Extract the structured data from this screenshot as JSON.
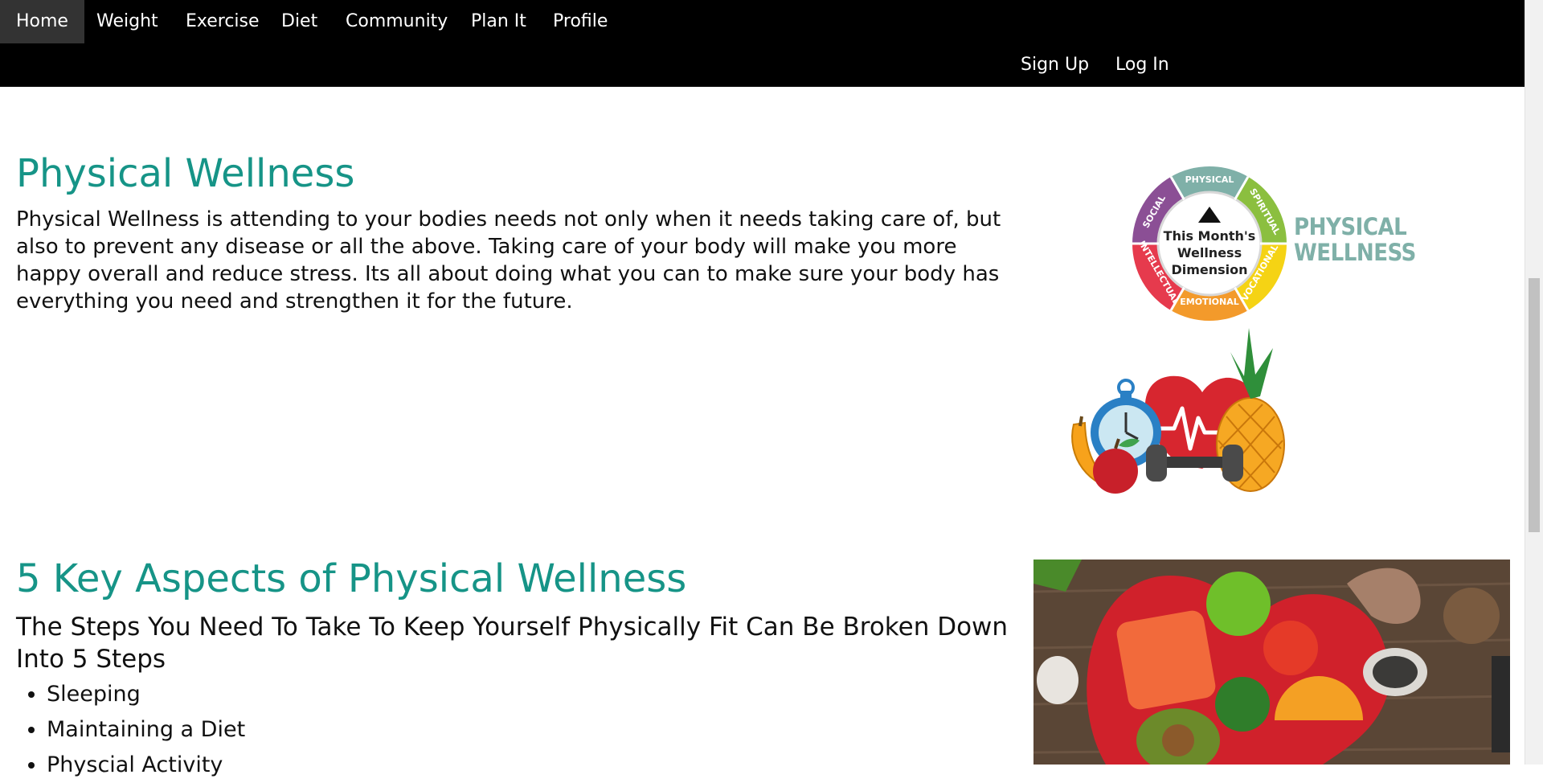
{
  "nav": {
    "items": [
      "Home",
      "Weight",
      "Exercise",
      "Diet",
      "Community",
      "Plan It",
      "Profile"
    ],
    "active": "Home",
    "right": [
      "Sign Up",
      "Log In"
    ]
  },
  "section1": {
    "title": "Physical Wellness",
    "body": "Physical Wellness is attending to your bodies needs not only when it needs taking care of, but also to prevent any disease or all the above. Taking care of your body will make you more happy overall and reduce stress. Its all about doing what you can to make sure your body has everything you need and strengthen it for the future."
  },
  "wheel": {
    "center": [
      "This Month's",
      "Wellness",
      "Dimension"
    ],
    "segments": [
      "PHYSICAL",
      "SPIRITUAL",
      "VOCATIONAL",
      "EMOTIONAL",
      "INTELLECTUAL",
      "SOCIAL"
    ],
    "colors": [
      "#7fb0a8",
      "#8bbf3f",
      "#f5d314",
      "#f39a2b",
      "#e63a4d",
      "#8b4f95"
    ],
    "label": [
      "PHYSICAL",
      "WELLNESS"
    ]
  },
  "section2": {
    "title": "5 Key Aspects of Physical Wellness",
    "subtitle": "The Steps You Need To Take To Keep Yourself Physically Fit Can Be Broken Down Into 5 Steps",
    "steps": [
      "Sleeping",
      "Maintaining a Diet",
      "Physcial Activity"
    ]
  },
  "colors": {
    "accent": "#169487",
    "nav_bg": "#000000",
    "nav_active": "#333333"
  }
}
